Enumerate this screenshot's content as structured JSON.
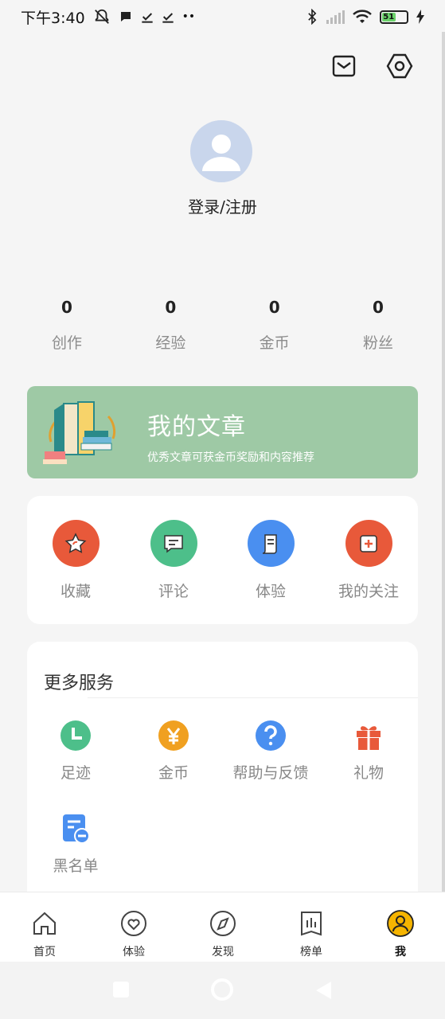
{
  "status_bar": {
    "time": "下午3:40",
    "battery_level": "51",
    "icons": [
      "mute-icon",
      "chat-icon",
      "download-icon",
      "download-icon",
      "more-dots-icon",
      "bluetooth-icon",
      "signal-icon",
      "wifi-icon",
      "battery-icon",
      "charging-icon"
    ]
  },
  "header": {
    "login_label": "登录/注册",
    "icons": [
      "mail-icon",
      "settings-icon"
    ]
  },
  "stats": [
    {
      "value": "0",
      "label": "创作"
    },
    {
      "value": "0",
      "label": "经验"
    },
    {
      "value": "0",
      "label": "金币"
    },
    {
      "value": "0",
      "label": "粉丝"
    }
  ],
  "banner": {
    "title": "我的文章",
    "subtitle": "优秀文章可获金币奖励和内容推荐",
    "color": "#9ec9a5"
  },
  "quick_actions": [
    {
      "label": "收藏",
      "icon": "star-icon",
      "color": "#e8593a"
    },
    {
      "label": "评论",
      "icon": "comment-icon",
      "color": "#4dbf8a"
    },
    {
      "label": "体验",
      "icon": "document-icon",
      "color": "#4a8ff0"
    },
    {
      "label": "我的关注",
      "icon": "plus-square-icon",
      "color": "#e8593a"
    }
  ],
  "services": {
    "title": "更多服务",
    "items": [
      {
        "label": "足迹",
        "icon": "clock-icon",
        "color": "#4dbf8a"
      },
      {
        "label": "金币",
        "icon": "yen-coin-icon",
        "color": "#f0a020"
      },
      {
        "label": "帮助与反馈",
        "icon": "help-icon",
        "color": "#4a8ff0"
      },
      {
        "label": "礼物",
        "icon": "gift-icon",
        "color": "#e8593a"
      },
      {
        "label": "黑名单",
        "icon": "blacklist-icon",
        "color": "#4a8ff0"
      }
    ]
  },
  "tabbar": {
    "tabs": [
      {
        "label": "首页",
        "icon": "home-icon"
      },
      {
        "label": "体验",
        "icon": "heart-icon"
      },
      {
        "label": "发现",
        "icon": "compass-icon"
      },
      {
        "label": "榜单",
        "icon": "ranking-icon"
      },
      {
        "label": "我",
        "icon": "profile-icon",
        "active": true
      }
    ],
    "active_color": "#f5b400"
  }
}
